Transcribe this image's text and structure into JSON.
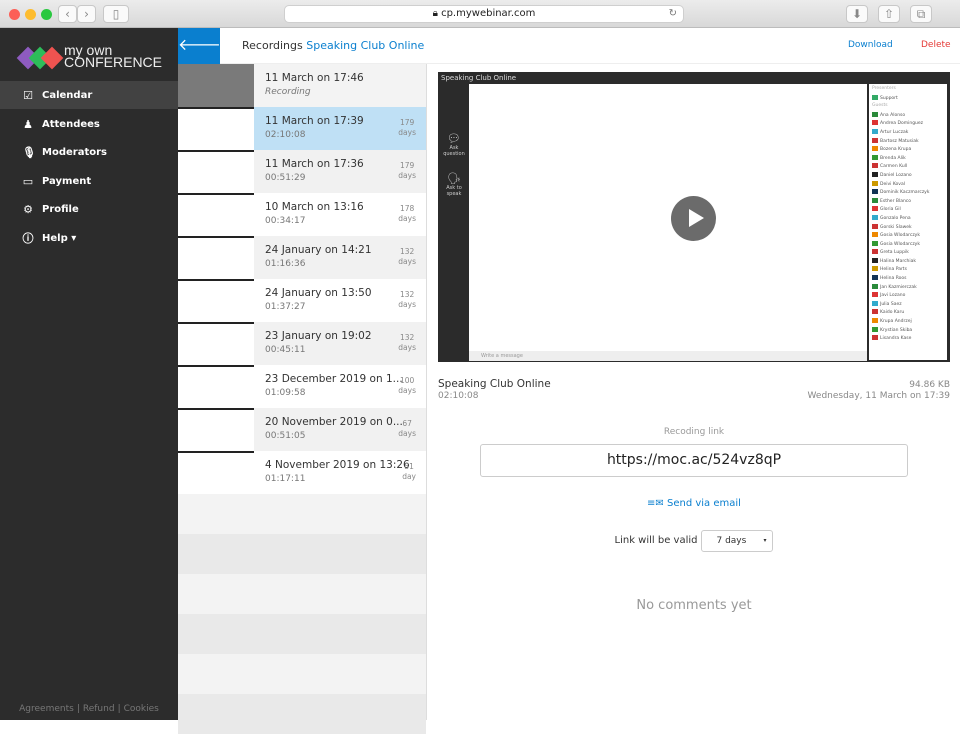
{
  "browser": {
    "url": "cp.mywebinar.com"
  },
  "logo": {
    "line1": "my own",
    "line2": "CONFERENCE",
    "colors": [
      "#8e5bc0",
      "#2dbd5a",
      "#ef5350"
    ]
  },
  "sidebar": {
    "items": [
      {
        "label": "Calendar",
        "icon": "calendar-icon"
      },
      {
        "label": "Attendees",
        "icon": "attendees-icon"
      },
      {
        "label": "Moderators",
        "icon": "microphone-icon"
      },
      {
        "label": "Payment",
        "icon": "credit-card-icon"
      },
      {
        "label": "Profile",
        "icon": "gear-icon"
      },
      {
        "label": "Help",
        "icon": "info-icon"
      }
    ],
    "footer": [
      "Agreements",
      "Refund",
      "Cookies"
    ]
  },
  "header": {
    "title": "Recordings",
    "event": "Speaking Club Online",
    "download": "Download",
    "delete": "Delete"
  },
  "recordings": [
    {
      "date": "11 March on 17:46",
      "sub": "Recording",
      "days": "",
      "unit": ""
    },
    {
      "date": "11 March on 17:39",
      "sub": "02:10:08",
      "days": "179",
      "unit": "days"
    },
    {
      "date": "11 March on 17:36",
      "sub": "00:51:29",
      "days": "179",
      "unit": "days"
    },
    {
      "date": "10 March on 13:16",
      "sub": "00:34:17",
      "days": "178",
      "unit": "days"
    },
    {
      "date": "24 January on 14:21",
      "sub": "01:16:36",
      "days": "132",
      "unit": "days"
    },
    {
      "date": "24 January on 13:50",
      "sub": "01:37:27",
      "days": "132",
      "unit": "days"
    },
    {
      "date": "23 January on 19:02",
      "sub": "00:45:11",
      "days": "132",
      "unit": "days"
    },
    {
      "date": "23 December 2019 on 1...",
      "sub": "01:09:58",
      "days": "100",
      "unit": "days"
    },
    {
      "date": "20 November 2019 on 0...",
      "sub": "00:51:05",
      "days": "67",
      "unit": "days"
    },
    {
      "date": "4 November 2019 on 13:26",
      "sub": "01:17:11",
      "days": "51",
      "unit": "day"
    }
  ],
  "player": {
    "title": "Speaking Club Online",
    "ask_question": "Ask question",
    "ask_speak": "Ask to speak",
    "chat_placeholder": "Write a message",
    "presenters": "Presenters",
    "support": "Support",
    "guests": "Guests",
    "participants": [
      "Ana Alonso",
      "Andrea Dominguez",
      "Artur Luczak",
      "Bartosz Matusiak",
      "Bozena Krupa",
      "Brenda Alik",
      "Carmen Kull",
      "Daniel Lozano",
      "Deivi Koval",
      "Dominik Kaczmarczyk",
      "Esther Blanco",
      "Gloria Gil",
      "Gonzalo Pena",
      "Gorski Slawek",
      "Gosia Wlodarczyk",
      "Gosia Wlodarczyk",
      "Greta Luppik",
      "Halina Marchiak",
      "Helina Parts",
      "Helina Roos",
      "Jan Kazmierczak",
      "Javi Lozano",
      "Julia Saez",
      "Kaido Karu",
      "Krupa Andrzej",
      "Krystian Skiba",
      "Lisandra Kase"
    ]
  },
  "details": {
    "title": "Speaking Club Online",
    "duration": "02:10:08",
    "size": "94.86 KB",
    "date": "Wednesday, 11 March on 17:39",
    "link_label": "Recoding link",
    "link": "https://moc.ac/524vz8qP",
    "send_email": "Send via email",
    "valid_label": "Link will be valid",
    "valid_value": "7 days",
    "no_comments": "No comments yet"
  }
}
